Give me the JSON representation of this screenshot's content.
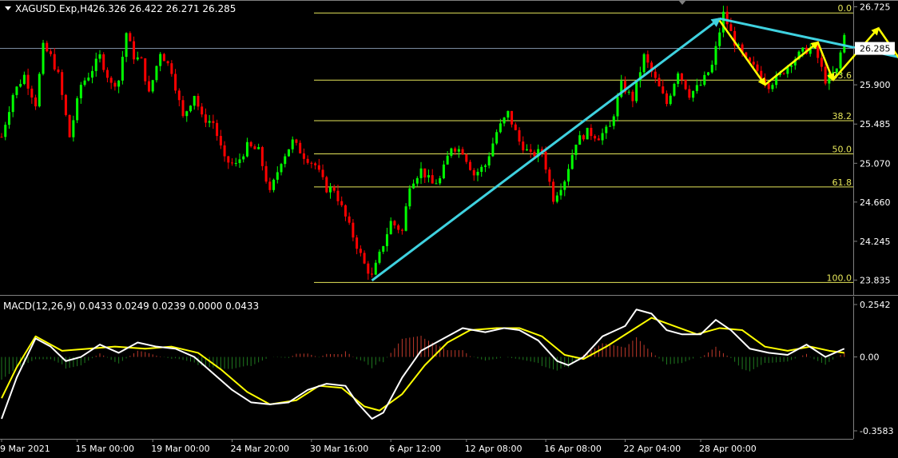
{
  "header": {
    "symbol_timeframe": "XAGUSD.Exp,H4",
    "ohlc": "26.326 26.422 26.271 26.285"
  },
  "macd": {
    "label": "MACD(12,26,9) 0.0433 0.0249 0.0239 0.0000 0.0433"
  },
  "colors": {
    "background": "#000000",
    "bull": "#00ff00",
    "bear": "#ff0000",
    "fib": "#e6e65a",
    "trend": "#3fd2e0",
    "forecast": "#ffff00",
    "macd_main": "#ffffff",
    "macd_signal": "#ffff00"
  },
  "chart_data": [
    {
      "type": "candlestick",
      "title": "XAGUSD.Exp,H4",
      "current_price": 26.285,
      "ylim": [
        23.72,
        26.78
      ],
      "y_ticks": [
        "26.725",
        "26.285",
        "25.900",
        "25.485",
        "25.070",
        "24.660",
        "24.245",
        "23.835"
      ],
      "x_ticks": [
        "9 Mar 2021",
        "15 Mar 00:00",
        "19 Mar 00:00",
        "24 Mar 20:00",
        "30 Mar 16:00",
        "6 Apr 12:00",
        "12 Apr 08:00",
        "16 Apr 08:00",
        "22 Apr 04:00",
        "28 Apr 00:00"
      ],
      "fibonacci_levels": [
        {
          "label": "0.0",
          "price": 26.66
        },
        {
          "label": "23.6",
          "price": 25.95
        },
        {
          "label": "38.2",
          "price": 25.52
        },
        {
          "label": "50.0",
          "price": 25.17
        },
        {
          "label": "61.8",
          "price": 24.82
        },
        {
          "label": "100.0",
          "price": 23.81
        }
      ],
      "price_path": [
        {
          "bar": 0,
          "price": 25.35
        },
        {
          "bar": 3,
          "price": 25.8
        },
        {
          "bar": 6,
          "price": 26.0
        },
        {
          "bar": 9,
          "price": 25.7
        },
        {
          "bar": 11,
          "price": 26.3
        },
        {
          "bar": 13,
          "price": 26.2
        },
        {
          "bar": 15,
          "price": 26.0
        },
        {
          "bar": 18,
          "price": 25.35
        },
        {
          "bar": 21,
          "price": 25.9
        },
        {
          "bar": 23,
          "price": 26.0
        },
        {
          "bar": 26,
          "price": 26.2
        },
        {
          "bar": 29,
          "price": 25.9
        },
        {
          "bar": 31,
          "price": 25.95
        },
        {
          "bar": 33,
          "price": 26.45
        },
        {
          "bar": 35,
          "price": 26.2
        },
        {
          "bar": 37,
          "price": 26.15
        },
        {
          "bar": 39,
          "price": 25.8
        },
        {
          "bar": 42,
          "price": 26.25
        },
        {
          "bar": 45,
          "price": 26.05
        },
        {
          "bar": 48,
          "price": 25.55
        },
        {
          "bar": 51,
          "price": 25.8
        },
        {
          "bar": 53,
          "price": 25.55
        },
        {
          "bar": 56,
          "price": 25.5
        },
        {
          "bar": 59,
          "price": 25.1
        },
        {
          "bar": 62,
          "price": 25.05
        },
        {
          "bar": 65,
          "price": 25.25
        },
        {
          "bar": 68,
          "price": 25.2
        },
        {
          "bar": 71,
          "price": 24.75
        },
        {
          "bar": 74,
          "price": 25.1
        },
        {
          "bar": 77,
          "price": 25.3
        },
        {
          "bar": 80,
          "price": 25.15
        },
        {
          "bar": 83,
          "price": 25.05
        },
        {
          "bar": 86,
          "price": 24.8
        },
        {
          "bar": 88,
          "price": 24.8
        },
        {
          "bar": 91,
          "price": 24.5
        },
        {
          "bar": 93,
          "price": 24.3
        },
        {
          "bar": 96,
          "price": 24.0
        },
        {
          "bar": 98,
          "price": 23.87
        },
        {
          "bar": 100,
          "price": 24.1
        },
        {
          "bar": 103,
          "price": 24.45
        },
        {
          "bar": 106,
          "price": 24.35
        },
        {
          "bar": 108,
          "price": 24.85
        },
        {
          "bar": 111,
          "price": 25.0
        },
        {
          "bar": 114,
          "price": 24.85
        },
        {
          "bar": 116,
          "price": 24.9
        },
        {
          "bar": 119,
          "price": 25.25
        },
        {
          "bar": 122,
          "price": 25.2
        },
        {
          "bar": 125,
          "price": 24.95
        },
        {
          "bar": 128,
          "price": 25.05
        },
        {
          "bar": 131,
          "price": 25.4
        },
        {
          "bar": 134,
          "price": 25.6
        },
        {
          "bar": 137,
          "price": 25.3
        },
        {
          "bar": 140,
          "price": 25.15
        },
        {
          "bar": 143,
          "price": 25.2
        },
        {
          "bar": 146,
          "price": 24.7
        },
        {
          "bar": 149,
          "price": 24.9
        },
        {
          "bar": 152,
          "price": 25.3
        },
        {
          "bar": 155,
          "price": 25.4
        },
        {
          "bar": 158,
          "price": 25.35
        },
        {
          "bar": 161,
          "price": 25.45
        },
        {
          "bar": 164,
          "price": 25.9
        },
        {
          "bar": 167,
          "price": 25.75
        },
        {
          "bar": 170,
          "price": 26.2
        },
        {
          "bar": 173,
          "price": 25.95
        },
        {
          "bar": 176,
          "price": 25.7
        },
        {
          "bar": 179,
          "price": 26.05
        },
        {
          "bar": 182,
          "price": 25.8
        },
        {
          "bar": 185,
          "price": 25.9
        },
        {
          "bar": 188,
          "price": 26.1
        },
        {
          "bar": 191,
          "price": 26.65
        },
        {
          "bar": 194,
          "price": 26.35
        },
        {
          "bar": 197,
          "price": 26.15
        },
        {
          "bar": 200,
          "price": 26.05
        },
        {
          "bar": 203,
          "price": 25.9
        },
        {
          "bar": 206,
          "price": 26.0
        },
        {
          "bar": 209,
          "price": 26.15
        },
        {
          "bar": 212,
          "price": 26.25
        },
        {
          "bar": 215,
          "price": 26.3
        },
        {
          "bar": 218,
          "price": 25.95
        },
        {
          "bar": 221,
          "price": 26.05
        },
        {
          "bar": 223,
          "price": 26.42
        }
      ],
      "trendlines": [
        {
          "name": "up-trend",
          "from": {
            "bar": 98,
            "price": 23.83
          },
          "to": {
            "bar": 190,
            "price": 26.6
          }
        },
        {
          "name": "down-trend",
          "from": {
            "bar": 190,
            "price": 26.6
          },
          "to": {
            "bar": 268,
            "price": 25.93
          }
        }
      ],
      "forecast_path": [
        {
          "bar": 190,
          "price": 26.58
        },
        {
          "bar": 202,
          "price": 25.9
        },
        {
          "bar": 216,
          "price": 26.35
        },
        {
          "bar": 220,
          "price": 25.95
        },
        {
          "bar": 232,
          "price": 26.5
        },
        {
          "bar": 242,
          "price": 25.92
        },
        {
          "bar": 257,
          "price": 26.32
        },
        {
          "bar": 264,
          "price": 26.0
        }
      ]
    },
    {
      "type": "macd",
      "title": "MACD(12,26,9)",
      "parameters": [
        12,
        26,
        9
      ],
      "values": [
        0.0433,
        0.0249,
        0.0239,
        0.0,
        0.0433
      ],
      "ylim": [
        -0.3583,
        0.2542
      ],
      "y_ticks": [
        "0.2542",
        "0.00",
        "-0.3583"
      ],
      "macd_line": [
        {
          "bar": 0,
          "value": -0.3
        },
        {
          "bar": 4,
          "value": -0.1
        },
        {
          "bar": 9,
          "value": 0.09
        },
        {
          "bar": 13,
          "value": 0.05
        },
        {
          "bar": 17,
          "value": -0.02
        },
        {
          "bar": 21,
          "value": 0.0
        },
        {
          "bar": 26,
          "value": 0.06
        },
        {
          "bar": 31,
          "value": 0.02
        },
        {
          "bar": 36,
          "value": 0.07
        },
        {
          "bar": 41,
          "value": 0.05
        },
        {
          "bar": 46,
          "value": 0.04
        },
        {
          "bar": 51,
          "value": 0.0
        },
        {
          "bar": 56,
          "value": -0.08
        },
        {
          "bar": 61,
          "value": -0.16
        },
        {
          "bar": 66,
          "value": -0.22
        },
        {
          "bar": 71,
          "value": -0.23
        },
        {
          "bar": 76,
          "value": -0.22
        },
        {
          "bar": 81,
          "value": -0.16
        },
        {
          "bar": 86,
          "value": -0.13
        },
        {
          "bar": 91,
          "value": -0.14
        },
        {
          "bar": 94,
          "value": -0.22
        },
        {
          "bar": 98,
          "value": -0.3
        },
        {
          "bar": 101,
          "value": -0.27
        },
        {
          "bar": 106,
          "value": -0.1
        },
        {
          "bar": 111,
          "value": 0.03
        },
        {
          "bar": 117,
          "value": 0.09
        },
        {
          "bar": 122,
          "value": 0.14
        },
        {
          "bar": 128,
          "value": 0.12
        },
        {
          "bar": 133,
          "value": 0.14
        },
        {
          "bar": 137,
          "value": 0.13
        },
        {
          "bar": 142,
          "value": 0.08
        },
        {
          "bar": 147,
          "value": -0.02
        },
        {
          "bar": 150,
          "value": -0.04
        },
        {
          "bar": 154,
          "value": 0.0
        },
        {
          "bar": 159,
          "value": 0.1
        },
        {
          "bar": 165,
          "value": 0.15
        },
        {
          "bar": 168,
          "value": 0.23
        },
        {
          "bar": 172,
          "value": 0.21
        },
        {
          "bar": 176,
          "value": 0.13
        },
        {
          "bar": 180,
          "value": 0.11
        },
        {
          "bar": 185,
          "value": 0.11
        },
        {
          "bar": 189,
          "value": 0.18
        },
        {
          "bar": 193,
          "value": 0.13
        },
        {
          "bar": 198,
          "value": 0.04
        },
        {
          "bar": 203,
          "value": 0.02
        },
        {
          "bar": 208,
          "value": 0.01
        },
        {
          "bar": 213,
          "value": 0.06
        },
        {
          "bar": 218,
          "value": 0.0
        },
        {
          "bar": 223,
          "value": 0.04
        }
      ],
      "signal_line": [
        {
          "bar": 0,
          "value": -0.2
        },
        {
          "bar": 4,
          "value": -0.05
        },
        {
          "bar": 9,
          "value": 0.1
        },
        {
          "bar": 16,
          "value": 0.03
        },
        {
          "bar": 23,
          "value": 0.04
        },
        {
          "bar": 30,
          "value": 0.05
        },
        {
          "bar": 38,
          "value": 0.04
        },
        {
          "bar": 45,
          "value": 0.05
        },
        {
          "bar": 52,
          "value": 0.02
        },
        {
          "bar": 58,
          "value": -0.06
        },
        {
          "bar": 65,
          "value": -0.17
        },
        {
          "bar": 71,
          "value": -0.23
        },
        {
          "bar": 78,
          "value": -0.21
        },
        {
          "bar": 84,
          "value": -0.14
        },
        {
          "bar": 90,
          "value": -0.15
        },
        {
          "bar": 96,
          "value": -0.24
        },
        {
          "bar": 100,
          "value": -0.26
        },
        {
          "bar": 106,
          "value": -0.18
        },
        {
          "bar": 112,
          "value": -0.04
        },
        {
          "bar": 118,
          "value": 0.07
        },
        {
          "bar": 124,
          "value": 0.13
        },
        {
          "bar": 131,
          "value": 0.14
        },
        {
          "bar": 137,
          "value": 0.14
        },
        {
          "bar": 143,
          "value": 0.1
        },
        {
          "bar": 149,
          "value": 0.01
        },
        {
          "bar": 154,
          "value": -0.01
        },
        {
          "bar": 160,
          "value": 0.05
        },
        {
          "bar": 166,
          "value": 0.12
        },
        {
          "bar": 172,
          "value": 0.19
        },
        {
          "bar": 178,
          "value": 0.15
        },
        {
          "bar": 184,
          "value": 0.11
        },
        {
          "bar": 190,
          "value": 0.14
        },
        {
          "bar": 196,
          "value": 0.13
        },
        {
          "bar": 202,
          "value": 0.05
        },
        {
          "bar": 208,
          "value": 0.03
        },
        {
          "bar": 214,
          "value": 0.05
        },
        {
          "bar": 219,
          "value": 0.03
        },
        {
          "bar": 223,
          "value": 0.02
        }
      ]
    }
  ]
}
